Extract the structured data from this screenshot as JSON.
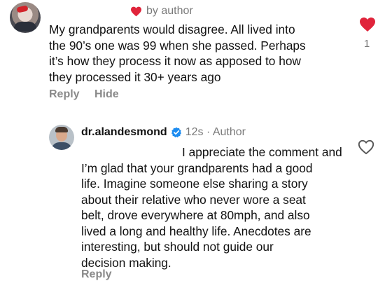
{
  "colors": {
    "like_red": "#e0243b",
    "verified_blue": "#1d8cf0",
    "secondary_text": "#7a7a7a"
  },
  "top_comment": {
    "author_badge_icon": "heart-icon",
    "author_badge_text": "by author",
    "text": "My grandparents would disagree. All lived into\nthe 90’s one was 99 when she passed. Perhaps\nit’s how they process it now as apposed to how\nthey processed it 30+ years ago",
    "reply_label": "Reply",
    "hide_label": "Hide",
    "like_icon": "heart-filled-icon",
    "like_count": "1"
  },
  "reply_comment": {
    "username": "dr.alandesmond",
    "verified_icon": "verified-badge-icon",
    "meta": "12s · Author",
    "text": "                              I appreciate the comment and\nI’m glad that your grandparents had a good\nlife. Imagine someone else sharing a story\nabout their relative who never wore a seat\nbelt, drove everywhere at 80mph, and also\nlived a long and healthy life. Anecdotes are\ninteresting, but should not guide our\ndecision making.",
    "reply_label": "Reply",
    "like_icon": "heart-outline-icon"
  }
}
